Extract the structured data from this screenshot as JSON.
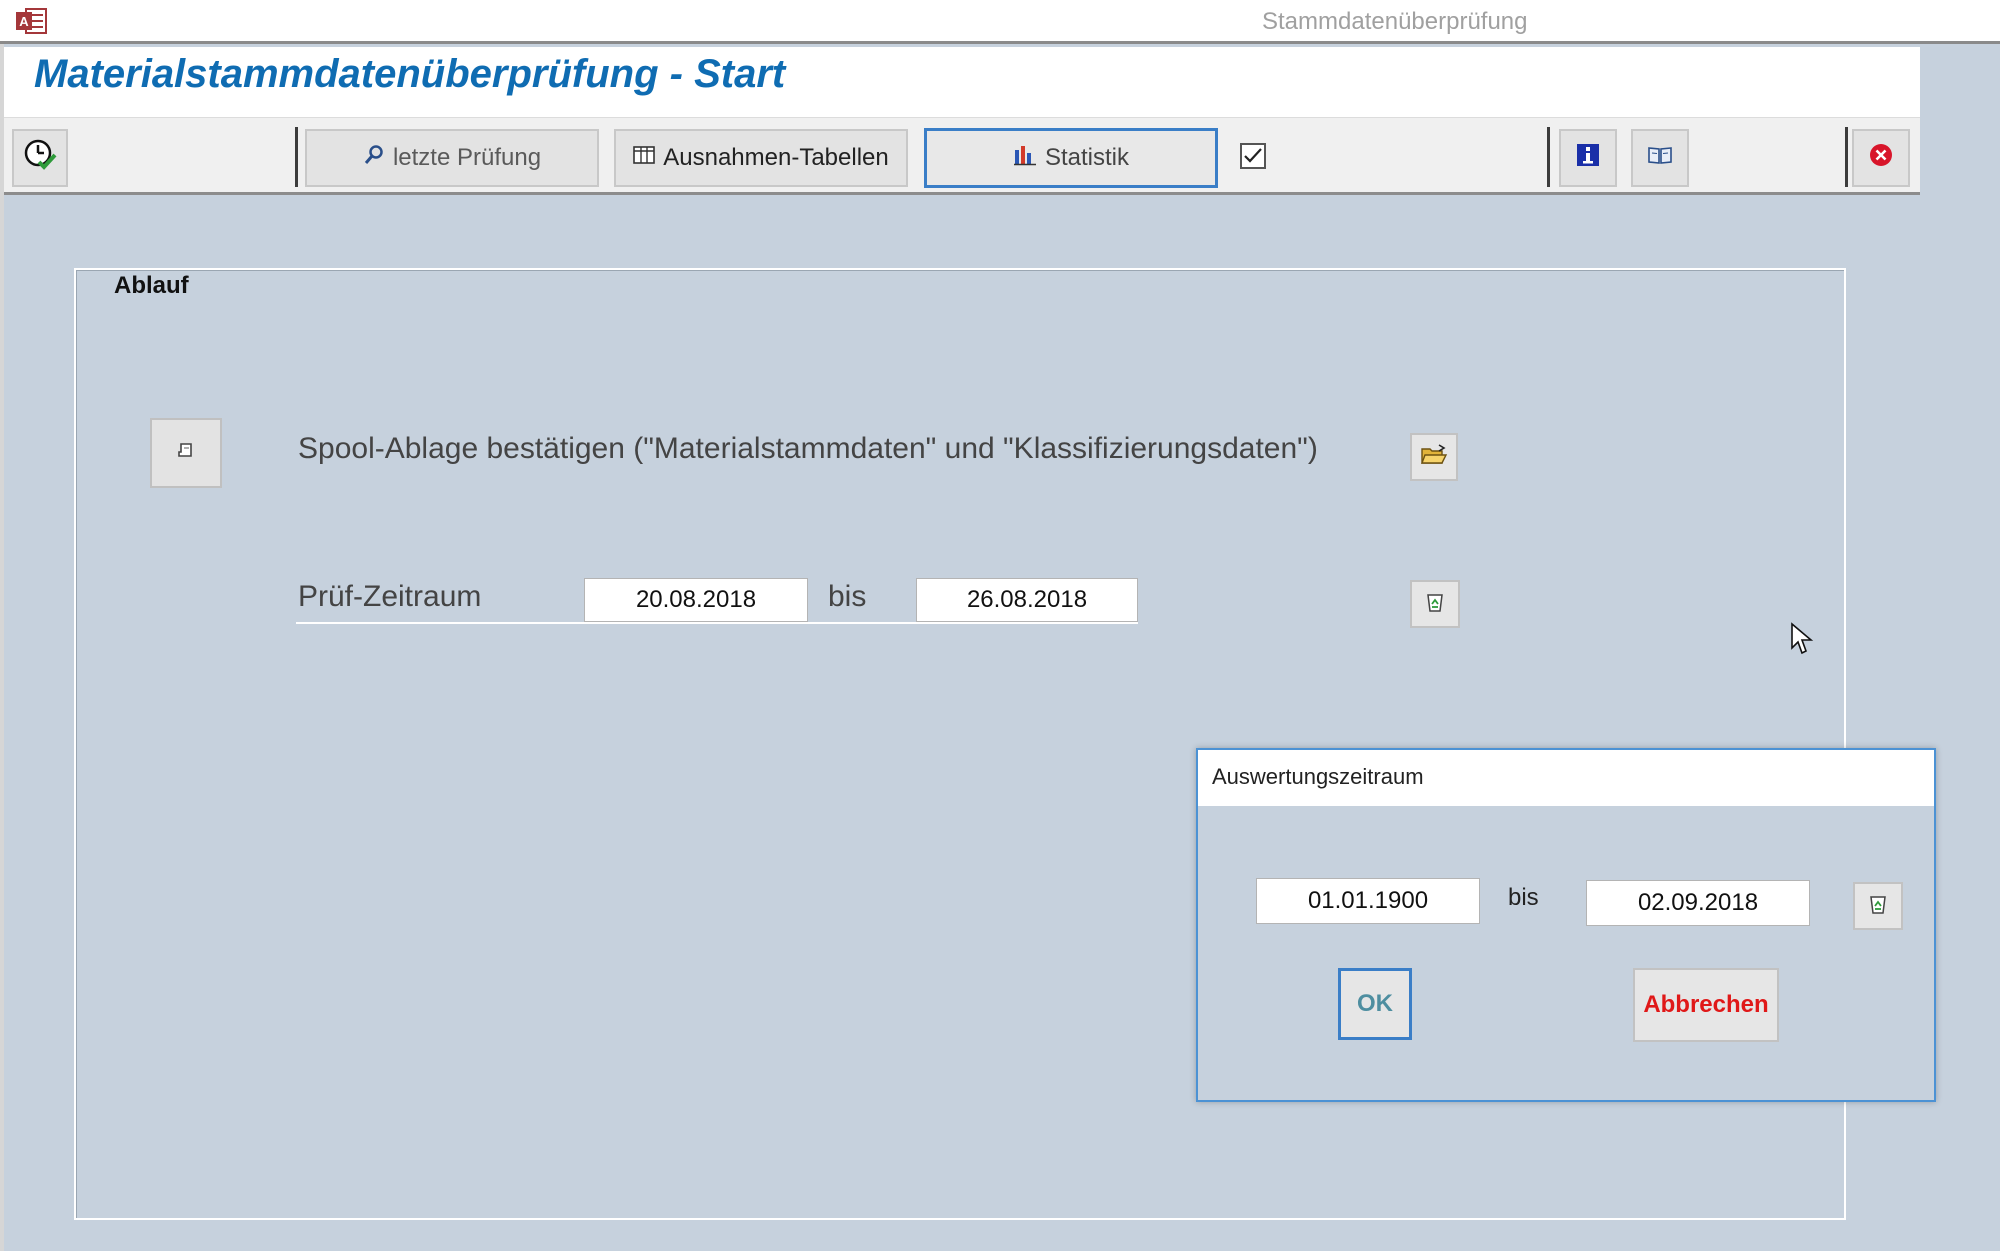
{
  "window": {
    "title": "Stammdatenüberprüfung"
  },
  "form": {
    "title": "Materialstammdatenüberprüfung - Start"
  },
  "toolbar": {
    "last_check_label": "letzte Prüfung",
    "exceptions_label": "Ausnahmen-Tabellen",
    "statistics_label": "Statistik",
    "checkbox_checked": true
  },
  "ablauf": {
    "label": "Ablauf",
    "spool_label": "Spool-Ablage bestätigen (\"Materialstammdaten\" und \"Klassifizierungsdaten\")",
    "period_label": "Prüf-Zeitraum",
    "period_from": "20.08.2018",
    "bis_label": "bis",
    "period_to": "26.08.2018"
  },
  "dialog": {
    "title": "Auswertungszeitraum",
    "from": "01.01.1900",
    "bis_label": "bis",
    "to": "02.09.2018",
    "ok_label": "OK",
    "cancel_label": "Abbrechen"
  },
  "colors": {
    "background": "#c6d1dd",
    "title_blue": "#0f6cb2",
    "focus_blue": "#3a7ec7",
    "cancel_red": "#e01818"
  }
}
